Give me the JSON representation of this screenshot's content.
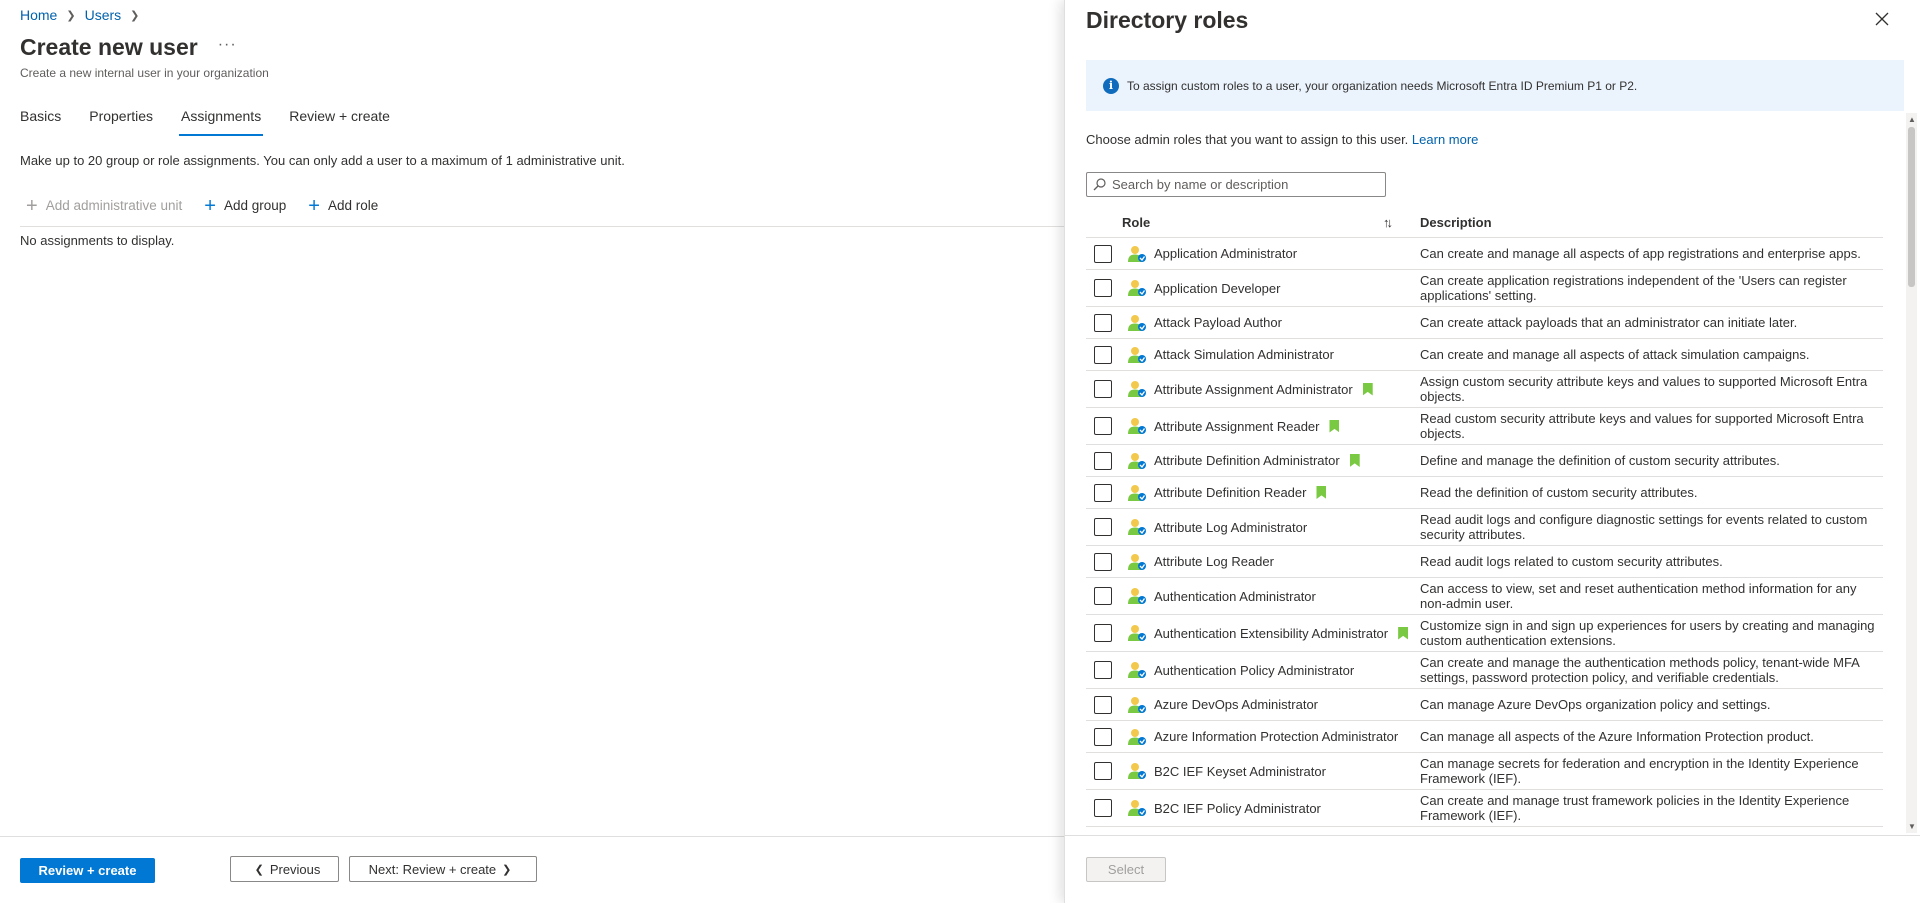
{
  "breadcrumb": {
    "home": "Home",
    "users": "Users"
  },
  "page": {
    "title": "Create new user",
    "more": "···",
    "subtitle": "Create a new internal user in your organization"
  },
  "tabs": [
    "Basics",
    "Properties",
    "Assignments",
    "Review + create"
  ],
  "active_tab": "Assignments",
  "assignments": {
    "info": "Make up to 20 group or role assignments. You can only add a user to a maximum of 1 administrative unit.",
    "toolbar": {
      "add_admin_unit": "Add administrative unit",
      "add_group": "Add group",
      "add_role": "Add role"
    },
    "empty": "No assignments to display."
  },
  "footer": {
    "review_create": "Review + create",
    "previous": "Previous",
    "next": "Next: Review + create"
  },
  "panel": {
    "title": "Directory roles",
    "info_banner": "To assign custom roles to a user, your organization needs Microsoft Entra ID Premium P1 or P2.",
    "choose_text": "Choose admin roles that you want to assign to this user.",
    "learn_more": "Learn more",
    "search_placeholder": "Search by name or description",
    "col_role": "Role",
    "col_description": "Description",
    "select_label": "Select",
    "roles": [
      {
        "name": "Application Administrator",
        "desc": "Can create and manage all aspects of app registrations and enterprise apps.",
        "marked": false
      },
      {
        "name": "Application Developer",
        "desc": "Can create application registrations independent of the 'Users can register applications' setting.",
        "marked": false
      },
      {
        "name": "Attack Payload Author",
        "desc": "Can create attack payloads that an administrator can initiate later.",
        "marked": false
      },
      {
        "name": "Attack Simulation Administrator",
        "desc": "Can create and manage all aspects of attack simulation campaigns.",
        "marked": false
      },
      {
        "name": "Attribute Assignment Administrator",
        "desc": "Assign custom security attribute keys and values to supported Microsoft Entra objects.",
        "marked": true
      },
      {
        "name": "Attribute Assignment Reader",
        "desc": "Read custom security attribute keys and values for supported Microsoft Entra objects.",
        "marked": true
      },
      {
        "name": "Attribute Definition Administrator",
        "desc": "Define and manage the definition of custom security attributes.",
        "marked": true
      },
      {
        "name": "Attribute Definition Reader",
        "desc": "Read the definition of custom security attributes.",
        "marked": true
      },
      {
        "name": "Attribute Log Administrator",
        "desc": "Read audit logs and configure diagnostic settings for events related to custom security attributes.",
        "marked": false
      },
      {
        "name": "Attribute Log Reader",
        "desc": "Read audit logs related to custom security attributes.",
        "marked": false
      },
      {
        "name": "Authentication Administrator",
        "desc": "Can access to view, set and reset authentication method information for any non-admin user.",
        "marked": false
      },
      {
        "name": "Authentication Extensibility Administrator",
        "desc": "Customize sign in and sign up experiences for users by creating and managing custom authentication extensions.",
        "marked": true
      },
      {
        "name": "Authentication Policy Administrator",
        "desc": "Can create and manage the authentication methods policy, tenant-wide MFA settings, password protection policy, and verifiable credentials.",
        "marked": false
      },
      {
        "name": "Azure DevOps Administrator",
        "desc": "Can manage Azure DevOps organization policy and settings.",
        "marked": false
      },
      {
        "name": "Azure Information Protection Administrator",
        "desc": "Can manage all aspects of the Azure Information Protection product.",
        "marked": false
      },
      {
        "name": "B2C IEF Keyset Administrator",
        "desc": "Can manage secrets for federation and encryption in the Identity Experience Framework (IEF).",
        "marked": false
      },
      {
        "name": "B2C IEF Policy Administrator",
        "desc": "Can create and manage trust framework policies in the Identity Experience Framework (IEF).",
        "marked": false
      }
    ]
  },
  "colors": {
    "accent": "#0078d4",
    "link": "#0062ad",
    "mark": "#7ac943",
    "info_bg": "#ebf3fc"
  }
}
